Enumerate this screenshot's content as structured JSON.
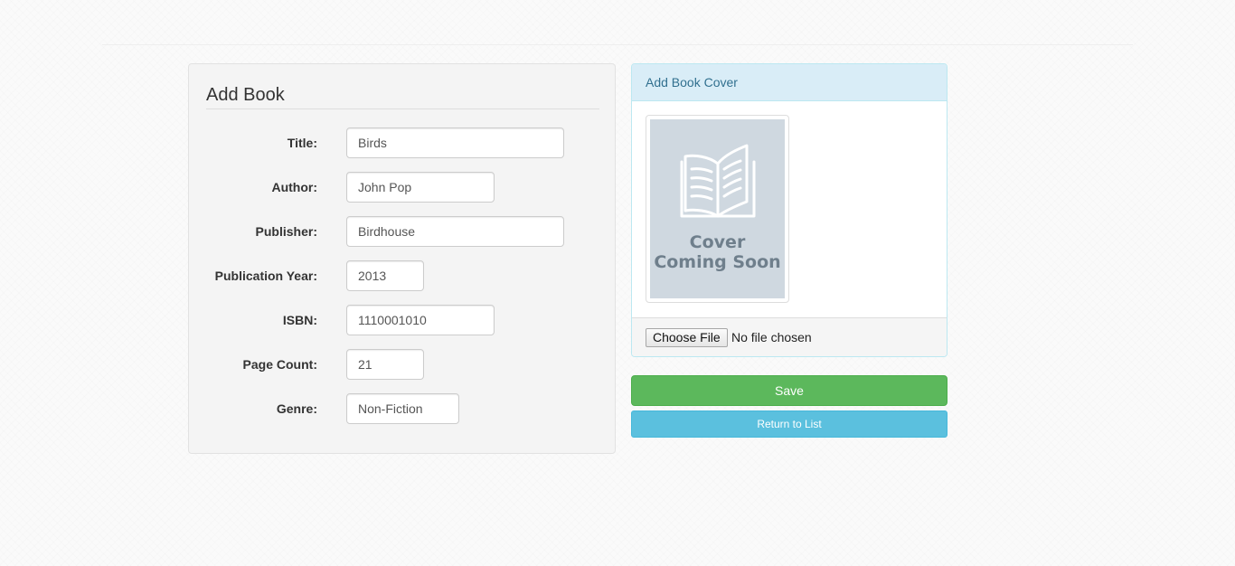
{
  "form": {
    "heading": "Add Book",
    "fields": [
      {
        "label": "Title:",
        "value": "Birds"
      },
      {
        "label": "Author:",
        "value": "John Pop"
      },
      {
        "label": "Publisher:",
        "value": "Birdhouse"
      },
      {
        "label": "Publication Year:",
        "value": "2013"
      },
      {
        "label": "ISBN:",
        "value": "1110001010"
      },
      {
        "label": "Page Count:",
        "value": "21"
      },
      {
        "label": "Genre:",
        "value": "Non-Fiction"
      }
    ]
  },
  "cover": {
    "heading": "Add Book Cover",
    "placeholder_line1": "Cover",
    "placeholder_line2": "Coming Soon",
    "placeholder_icon": "open-book-icon",
    "choose_file_label": "Choose File",
    "file_status": "No file chosen"
  },
  "actions": {
    "save_label": "Save",
    "return_label": "Return to List"
  },
  "colors": {
    "save": "#5cb85c",
    "return": "#5bc0de",
    "cover_heading_bg": "#d9edf7",
    "cover_heading_text": "#31708f",
    "cover_placeholder_bg": "#cfd8e0"
  }
}
